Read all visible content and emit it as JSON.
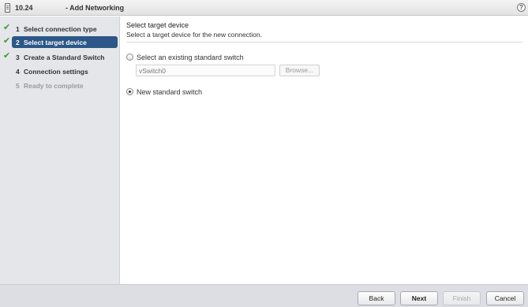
{
  "titlebar": {
    "host": "10.24",
    "title": "- Add Networking",
    "help_icon": "?",
    "host_icon": "host-icon"
  },
  "steps": [
    {
      "num": "1",
      "label": "Select connection type",
      "state": "completed"
    },
    {
      "num": "2",
      "label": "Select target device",
      "state": "active"
    },
    {
      "num": "3",
      "label": "Create a Standard Switch",
      "state": "completed"
    },
    {
      "num": "4",
      "label": "Connection settings",
      "state": "upcoming"
    },
    {
      "num": "5",
      "label": "Ready to complete",
      "state": "pending"
    }
  ],
  "main": {
    "title": "Select target device",
    "subtitle": "Select a target device for the new connection.",
    "options": [
      {
        "label": "Select an existing standard switch",
        "selected": false
      },
      {
        "label": "New standard switch",
        "selected": true
      }
    ],
    "switch_input_placeholder": "vSwitch0",
    "browse_label": "Browse..."
  },
  "footer": {
    "back": "Back",
    "next": "Next",
    "finish": "Finish",
    "cancel": "Cancel"
  },
  "colors": {
    "active_step_bg": "#2c5788",
    "check_green": "#3a9b2a",
    "sidebar_bg": "#e5e6ea"
  }
}
